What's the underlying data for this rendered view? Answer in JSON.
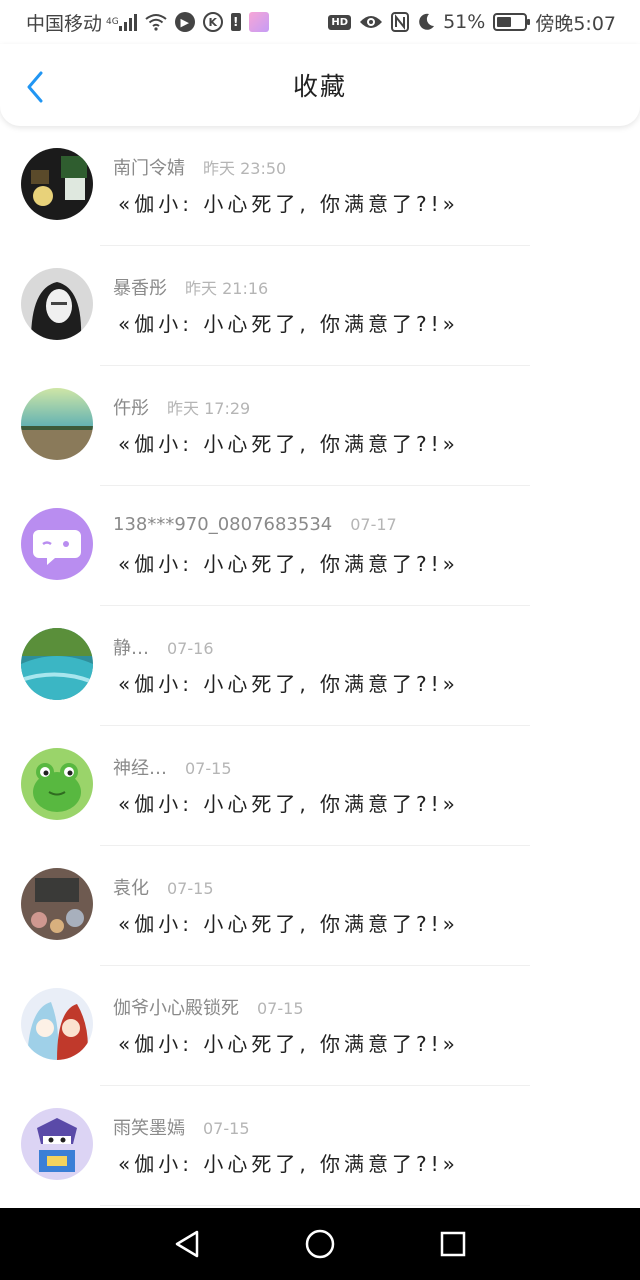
{
  "status_bar": {
    "carrier": "中国移动",
    "network": "4G",
    "battery_percent": "51%",
    "time": "傍晚5:07",
    "hd_label": "HD",
    "k_label": "K",
    "alert_label": "!"
  },
  "header": {
    "title": "收藏",
    "back_icon": "chevron-left-icon",
    "accent_color": "#2196f3"
  },
  "favorites": [
    {
      "name": "南门令婧",
      "time": "昨天 23:50",
      "message": "«伽小: 小心死了, 你满意了?!»"
    },
    {
      "name": "暴香彤",
      "time": "昨天 21:16",
      "message": "«伽小: 小心死了, 你满意了?!»"
    },
    {
      "name": "仵彤",
      "time": "昨天 17:29",
      "message": "«伽小: 小心死了, 你满意了?!»"
    },
    {
      "name": "138***970_0807683534",
      "time": "07-17",
      "message": "«伽小: 小心死了, 你满意了?!»"
    },
    {
      "name": "静…",
      "time": "07-16",
      "message": "«伽小: 小心死了, 你满意了?!»"
    },
    {
      "name": "神经…",
      "time": "07-15",
      "message": "«伽小: 小心死了, 你满意了?!»"
    },
    {
      "name": "袁化",
      "time": "07-15",
      "message": "«伽小: 小心死了, 你满意了?!»"
    },
    {
      "name": "伽爷小心殿锁死",
      "time": "07-15",
      "message": "«伽小: 小心死了, 你满意了?!»"
    },
    {
      "name": "雨笑墨嫣",
      "time": "07-15",
      "message": "«伽小: 小心死了, 你满意了?!»"
    }
  ],
  "nav_bar": {
    "back": "triangle-back-icon",
    "home": "circle-home-icon",
    "recents": "square-recents-icon"
  }
}
